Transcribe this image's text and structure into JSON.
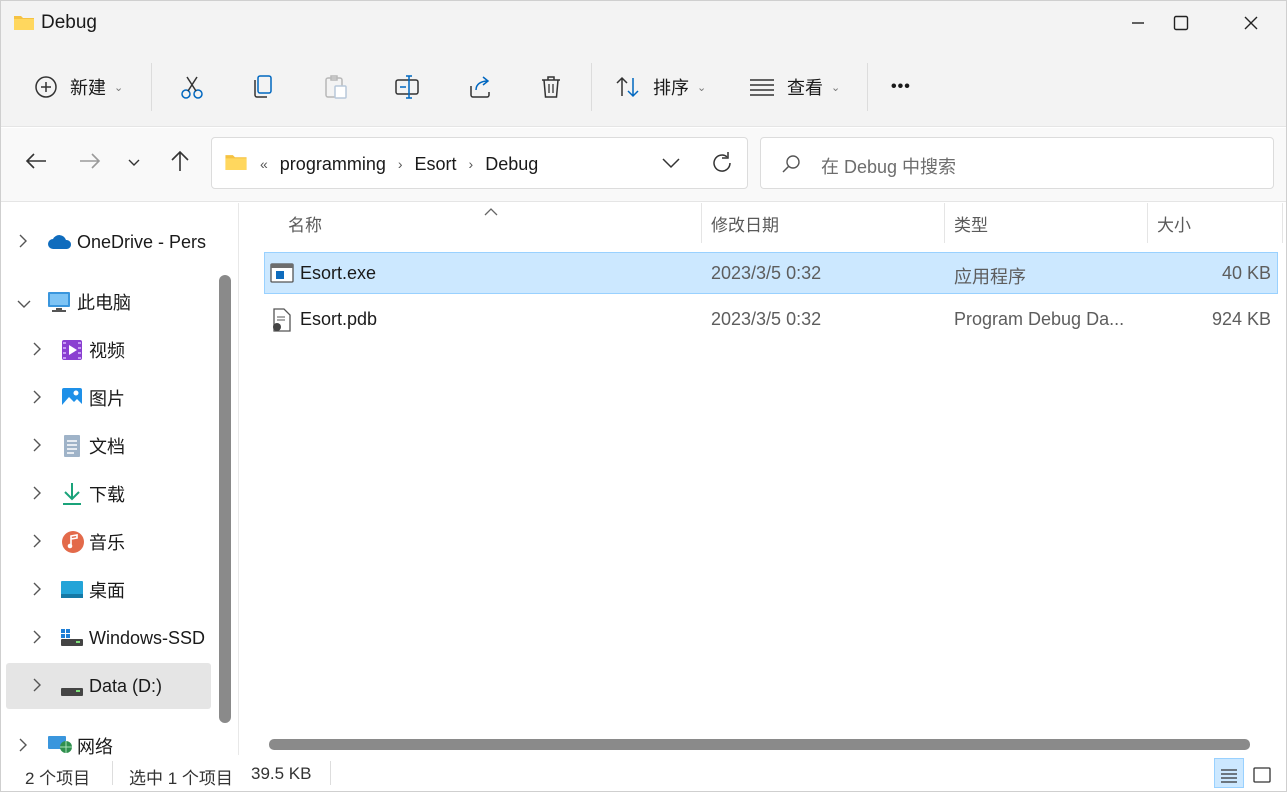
{
  "window": {
    "title": "Debug"
  },
  "toolbar": {
    "new_label": "新建",
    "sort_label": "排序",
    "view_label": "查看",
    "more_label": "•••"
  },
  "address": {
    "overflow": "«",
    "crumbs": [
      "programming",
      "Esort",
      "Debug"
    ],
    "search_placeholder": "在 Debug 中搜索"
  },
  "sidebar": {
    "items": [
      {
        "label": "OneDrive - Pers",
        "icon": "onedrive-icon"
      },
      {
        "label": "此电脑",
        "icon": "computer-icon"
      },
      {
        "label": "视频",
        "icon": "videos-icon"
      },
      {
        "label": "图片",
        "icon": "pictures-icon"
      },
      {
        "label": "文档",
        "icon": "documents-icon"
      },
      {
        "label": "下载",
        "icon": "downloads-icon"
      },
      {
        "label": "音乐",
        "icon": "music-icon"
      },
      {
        "label": "桌面",
        "icon": "desktop-icon"
      },
      {
        "label": "Windows-SSD",
        "icon": "drive-c-icon"
      },
      {
        "label": "Data (D:)",
        "icon": "drive-d-icon"
      },
      {
        "label": "网络",
        "icon": "network-icon"
      }
    ]
  },
  "columns": {
    "name": "名称",
    "modified": "修改日期",
    "type": "类型",
    "size": "大小"
  },
  "files": [
    {
      "name": "Esort.exe",
      "modified": "2023/3/5 0:32",
      "type": "应用程序",
      "size": "40 KB",
      "icon": "exe-icon",
      "selected": true
    },
    {
      "name": "Esort.pdb",
      "modified": "2023/3/5 0:32",
      "type": "Program Debug Da...",
      "size": "924 KB",
      "icon": "pdb-file-icon",
      "selected": false
    }
  ],
  "status": {
    "item_count": "2 个项目",
    "selection": "选中 1 个项目",
    "selection_size": "39.5 KB"
  },
  "colors": {
    "selection_bg": "#cce8ff",
    "selection_border": "#99d1ff",
    "folder_yellow": "#f5c242",
    "accent_blue": "#0067c0"
  }
}
